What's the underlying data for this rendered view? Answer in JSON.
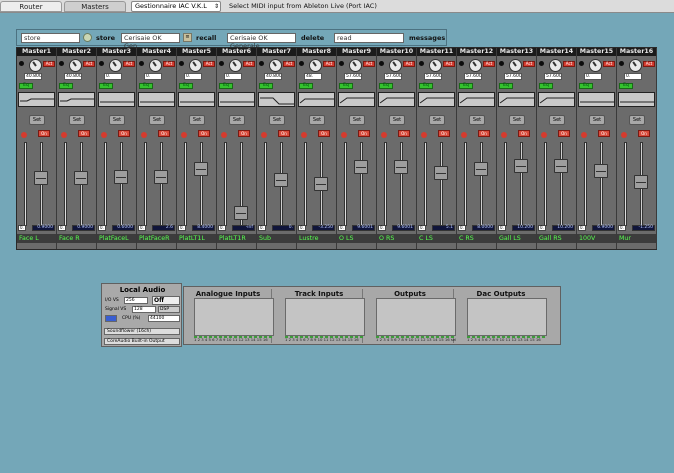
{
  "tabs": [
    {
      "label": "Router",
      "active": true
    },
    {
      "label": "Masters",
      "active": false
    }
  ],
  "midi": {
    "selected": "Gestionnaire IAC V.K.L",
    "status": "Select MIDI input from Ableton Live (Port IAC)"
  },
  "presets": {
    "store_input": "store",
    "store_label": "store",
    "recall_input": "Cerisaie OK Gen...",
    "recall_label": "recall",
    "delete_input": "Cerisaie OK Generale",
    "delete_label": "delete",
    "messages_input": "read",
    "messages_label": "messages"
  },
  "strip_labels": {
    "act": "Act",
    "eq": "Eq",
    "set": "Set",
    "on": "On"
  },
  "strips": [
    {
      "name": "Master1",
      "value": "40.800",
      "level": "0.",
      "output": "0.9000",
      "label": "Face L",
      "fader": 0.58
    },
    {
      "name": "Master2",
      "value": "40.800",
      "level": "0.",
      "output": "0.9000",
      "label": "Face R",
      "fader": 0.58
    },
    {
      "name": "Master3",
      "value": "0.",
      "level": "0.",
      "output": "0.6000",
      "label": "PlatFaceL",
      "fader": 0.6
    },
    {
      "name": "Master4",
      "value": "0.",
      "level": "0.",
      "output": "2.6",
      "label": "PlatFaceR",
      "fader": 0.6
    },
    {
      "name": "Master5",
      "value": "0.",
      "level": "0.",
      "output": "8.4000",
      "label": "PlatLT1L",
      "fader": 0.72
    },
    {
      "name": "Master6",
      "value": "0.",
      "level": "0.",
      "output": "-inf",
      "label": "PlatLT1R",
      "fader": 0.08
    },
    {
      "name": "Master7",
      "value": "40.800",
      "level": "0.",
      "output": "0.",
      "label": "Sub",
      "fader": 0.55
    },
    {
      "name": "Master8",
      "value": "48.",
      "level": "0.",
      "output": "-3.250",
      "label": "Lustre",
      "fader": 0.5
    },
    {
      "name": "Master9",
      "value": "57.600",
      "level": "0.",
      "output": "9.6001",
      "label": "O LS",
      "fader": 0.74
    },
    {
      "name": "Master10",
      "value": "57.600",
      "level": "0.",
      "output": "9.6001",
      "label": "O RS",
      "fader": 0.74
    },
    {
      "name": "Master11",
      "value": "57.600",
      "level": "0.",
      "output": "5.1",
      "label": "C LS",
      "fader": 0.66
    },
    {
      "name": "Master12",
      "value": "57.600",
      "level": "0.",
      "output": "8.0000",
      "label": "C RS",
      "fader": 0.71
    },
    {
      "name": "Master13",
      "value": "57.600",
      "level": "0.",
      "output": "10.200",
      "label": "Gall LS",
      "fader": 0.76
    },
    {
      "name": "Master14",
      "value": "57.600",
      "level": "0.",
      "output": "10.200",
      "label": "Gall RS",
      "fader": 0.76
    },
    {
      "name": "Master15",
      "value": "0.",
      "level": "0.",
      "output": "6.9000",
      "label": "100V",
      "fader": 0.68
    },
    {
      "name": "Master16",
      "value": "0.",
      "level": "0.",
      "output": "-1.250",
      "label": "Mur",
      "fader": 0.53
    }
  ],
  "local_audio": {
    "title": "Local Audio",
    "io_vs_label": "I/O VS",
    "io_vs_value": "256",
    "onoff": "Off",
    "signal_vs_label": "Signal VS",
    "signal_vs_value": "128",
    "dsp_label": "DSP",
    "cpu_label": "CPU (%)",
    "sample_rate": "44100",
    "device_in": "Soundflower (16ch)",
    "device_out": "CoreAudio Built-in Output"
  },
  "routing": [
    {
      "title": "Analogue Inputs",
      "numbers": "1 2 3 4 5 6 7 8 9 10 11 12 13 14 15 16"
    },
    {
      "title": "Track Inputs",
      "numbers": "1 2 3 4 5 6 7 8 9 10 11 12 13 14 15 16"
    },
    {
      "title": "Outputs",
      "numbers": "1 2 3 4 5 6 7 8 9 10 11 12 13 14 15 16 sel"
    },
    {
      "title": "Dac Outputs",
      "numbers": "1 2 3 4 5 6 7 8 9 10 11 12 13 14 15 16"
    }
  ]
}
